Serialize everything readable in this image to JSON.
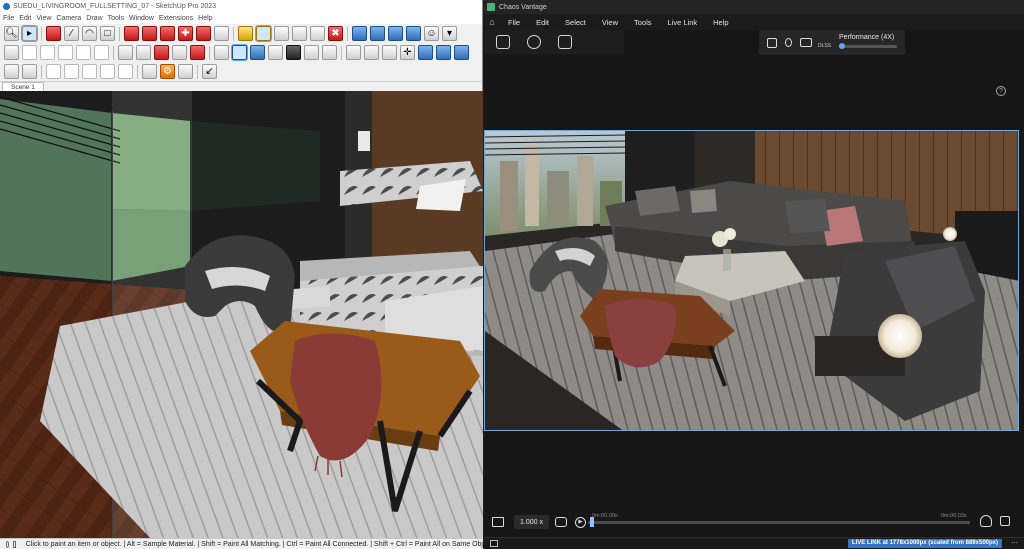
{
  "sketchup": {
    "title": "SUEDU_LIVINGROOM_FULLSETTING_07 - SketchUp Pro 2023",
    "menu": [
      "File",
      "Edit",
      "View",
      "Camera",
      "Draw",
      "Tools",
      "Window",
      "Extensions",
      "Help"
    ],
    "toolbar_row1": [
      "search-icon",
      "select-arrow-icon",
      "eraser-icon",
      "pencil-line-icon",
      "arc-icon",
      "rectangle-icon",
      "push-pull-icon",
      "follow-me-icon",
      "rotate-icon",
      "move-icon",
      "offset-icon",
      "scale-icon",
      "tape-measure-icon",
      "paint-bucket-icon",
      "zoom-icon",
      "zoom-extents-icon",
      "section-plane-icon",
      "layers-icon",
      "warehouse-icon",
      "extension-icon",
      "user-icon",
      "settings-icon"
    ],
    "toolbar_row2": [
      "camera-iso-icon",
      "box-icon",
      "box-front-icon",
      "box-side-icon",
      "box-top-icon",
      "style-xray-icon",
      "style-wire-icon",
      "style-hidden-icon",
      "style-shaded-icon",
      "style-texture-icon",
      "style-mono-icon",
      "geo-location-icon",
      "sandbox-icon",
      "solid-tools-icon",
      "walk-icon",
      "orbit-icon",
      "pan-icon",
      "look-around-icon",
      "scene-icon",
      "component-icon",
      "match-photo-icon",
      "layout-icon",
      "move-cube-icon",
      "cube-blue-icon",
      "cube-blue-2-icon",
      "cube-blue-3-icon"
    ],
    "toolbar_row3": [
      "dimension-icon",
      "text-icon",
      "box-outline-icon",
      "box-outline-2-icon",
      "box-outline-3-icon",
      "sphere-icon",
      "sphere-2-icon",
      "hand-icon",
      "gear-red-icon",
      "grid-icon",
      "small-arrow-icon"
    ],
    "scene_tab": "Scene 1",
    "status_text": "Click to paint an item or object. | Alt = Sample Material. | Shift = Paint All Matching. | Ctrl = Paint All Connected. | Shift + Ctrl = Paint All on Same Obj"
  },
  "vantage": {
    "title": "Chaos Vantage",
    "menu": [
      "File",
      "Edit",
      "Select",
      "View",
      "Tools",
      "Live Link",
      "Help"
    ],
    "performance": {
      "label": "Performance (4X)",
      "dlss": "DLSS",
      "level": 0.05
    },
    "timeline": {
      "speed": "1.000 x",
      "start": "0m:00.00s",
      "end": "0m:00.03s"
    },
    "live_link": "LIVE LINK at 1778x1000px (scaled from 889x500px)",
    "colors": {
      "accent": "#3575c4",
      "viewport_border": "#6ea9d9"
    }
  }
}
